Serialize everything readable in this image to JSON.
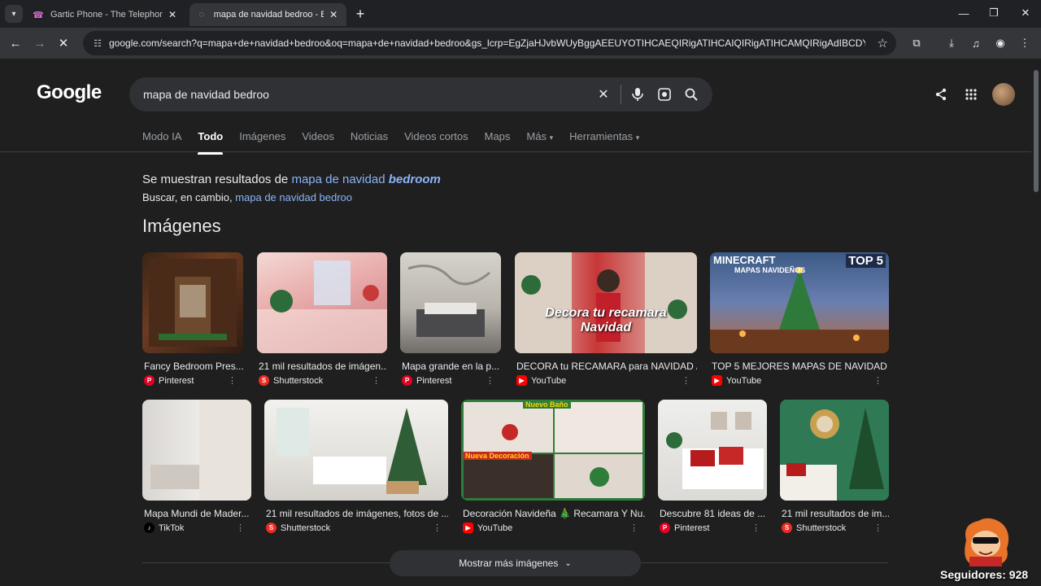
{
  "browser": {
    "tabs": [
      {
        "label": "Gartic Phone - The Telephone G",
        "active": false,
        "icon": "phone-icon"
      },
      {
        "label": "mapa de navidad bedroo - Busc",
        "active": true,
        "icon": "loading-icon"
      }
    ],
    "url": "google.com/search?q=mapa+de+navidad+bedroo&oq=mapa+de+navidad+bedroo&gs_lcrp=EgZjaHJvbWUyBggAEEUYOTIHCAEQIRigATIHCAIQIRigATIHCAMQIRigAdIBCDYxMjlq..."
  },
  "google": {
    "logo": "Google",
    "query": "mapa de navidad bedroo",
    "nav_tabs": [
      "Modo IA",
      "Todo",
      "Imágenes",
      "Videos",
      "Noticias",
      "Videos cortos",
      "Maps",
      "Más",
      "Herramientas"
    ],
    "active_tab": "Todo",
    "spell": {
      "prefix": "Se muestran resultados de",
      "corrected_plain": "mapa de navidad",
      "corrected_bold": "bedroom",
      "instead_prefix": "Buscar, en cambio,",
      "original": "mapa de navidad bedroo"
    },
    "images_title": "Imágenes",
    "image_results": [
      {
        "title": "Fancy Bedroom Pres...",
        "source": "Pinterest"
      },
      {
        "title": "21 mil resultados de imágen...",
        "source": "Shutterstock"
      },
      {
        "title": "Mapa grande en la p...",
        "source": "Pinterest"
      },
      {
        "title": "DECORA tu RECAMARA para NAVIDAD /...",
        "source": "YouTube",
        "overlay": "Decora tu recamara Navidad"
      },
      {
        "title": "TOP 5 MEJORES MAPAS DE NAVIDAD ...",
        "source": "YouTube",
        "overlay_main": "MINECRAFT",
        "overlay_sub": "MAPAS NAVIDEÑOS",
        "overlay_badge": "TOP 5"
      },
      {
        "title": "Mapa Mundi de Mader...",
        "source": "TikTok"
      },
      {
        "title": "21 mil resultados de imágenes, fotos de ...",
        "source": "Shutterstock"
      },
      {
        "title": "Decoración Navideña 🎄 Recamara Y Nu...",
        "source": "YouTube",
        "overlay_top": "Nuevo Baño",
        "overlay_bottom": "Nueva Decoración"
      },
      {
        "title": "Descubre 81 ideas de ...",
        "source": "Pinterest"
      },
      {
        "title": "21 mil resultados de im...",
        "source": "Shutterstock"
      }
    ],
    "more_images": "Mostrar más imágenes"
  },
  "overlay": {
    "followers": "Seguidores: 928"
  },
  "colors": {
    "background": "#1f1f1f",
    "link": "#8ab4f8",
    "pinterest": "#e60023",
    "shutterstock": "#ee2b24",
    "youtube": "#ff0000",
    "tiktok": "#000000"
  }
}
